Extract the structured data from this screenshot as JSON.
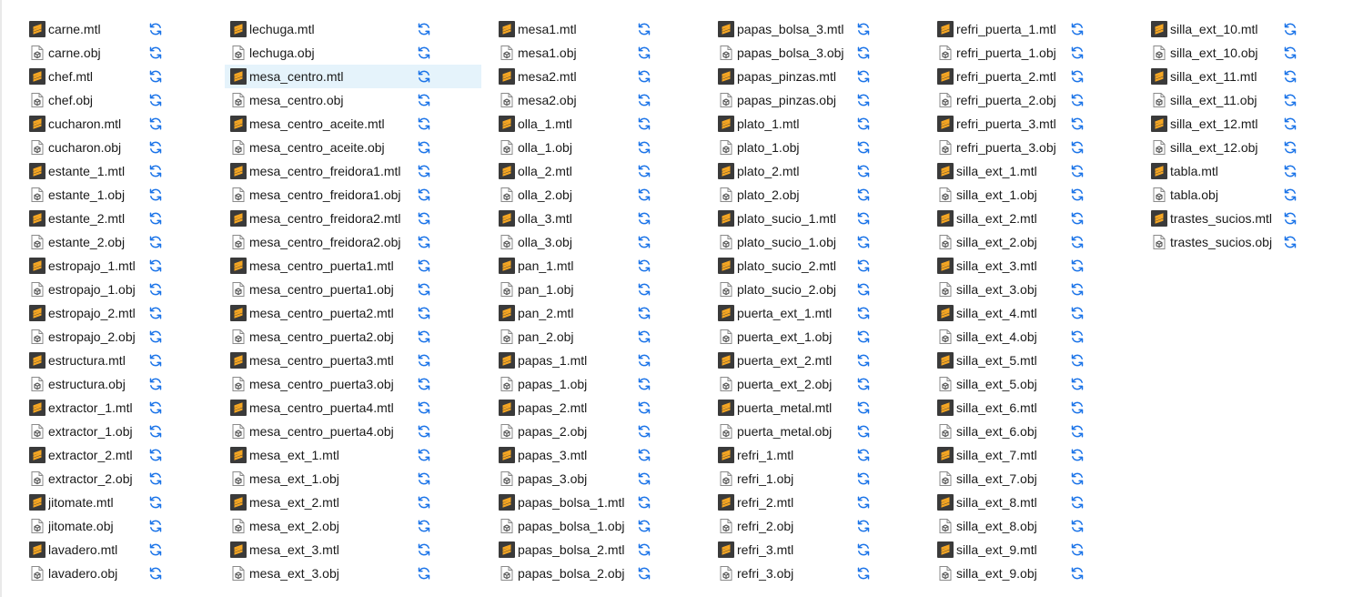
{
  "status_icon": "sync-pending-icon",
  "colors": {
    "accent": "#1a73e8",
    "selection": "#e5f3fb",
    "mtl_icon": "#f5a623",
    "obj_icon": "#555555"
  },
  "columns": [
    {
      "files": [
        {
          "name": "carne.mtl",
          "type": "mtl"
        },
        {
          "name": "carne.obj",
          "type": "obj"
        },
        {
          "name": "chef.mtl",
          "type": "mtl"
        },
        {
          "name": "chef.obj",
          "type": "obj"
        },
        {
          "name": "cucharon.mtl",
          "type": "mtl"
        },
        {
          "name": "cucharon.obj",
          "type": "obj"
        },
        {
          "name": "estante_1.mtl",
          "type": "mtl"
        },
        {
          "name": "estante_1.obj",
          "type": "obj"
        },
        {
          "name": "estante_2.mtl",
          "type": "mtl"
        },
        {
          "name": "estante_2.obj",
          "type": "obj"
        },
        {
          "name": "estropajo_1.mtl",
          "type": "mtl"
        },
        {
          "name": "estropajo_1.obj",
          "type": "obj"
        },
        {
          "name": "estropajo_2.mtl",
          "type": "mtl"
        },
        {
          "name": "estropajo_2.obj",
          "type": "obj"
        },
        {
          "name": "estructura.mtl",
          "type": "mtl"
        },
        {
          "name": "estructura.obj",
          "type": "obj"
        },
        {
          "name": "extractor_1.mtl",
          "type": "mtl"
        },
        {
          "name": "extractor_1.obj",
          "type": "obj"
        },
        {
          "name": "extractor_2.mtl",
          "type": "mtl"
        },
        {
          "name": "extractor_2.obj",
          "type": "obj"
        },
        {
          "name": "jitomate.mtl",
          "type": "mtl"
        },
        {
          "name": "jitomate.obj",
          "type": "obj"
        },
        {
          "name": "lavadero.mtl",
          "type": "mtl"
        },
        {
          "name": "lavadero.obj",
          "type": "obj"
        }
      ]
    },
    {
      "files": [
        {
          "name": "lechuga.mtl",
          "type": "mtl"
        },
        {
          "name": "lechuga.obj",
          "type": "obj"
        },
        {
          "name": "mesa_centro.mtl",
          "type": "mtl",
          "selected": true
        },
        {
          "name": "mesa_centro.obj",
          "type": "obj"
        },
        {
          "name": "mesa_centro_aceite.mtl",
          "type": "mtl"
        },
        {
          "name": "mesa_centro_aceite.obj",
          "type": "obj"
        },
        {
          "name": "mesa_centro_freidora1.mtl",
          "type": "mtl"
        },
        {
          "name": "mesa_centro_freidora1.obj",
          "type": "obj"
        },
        {
          "name": "mesa_centro_freidora2.mtl",
          "type": "mtl"
        },
        {
          "name": "mesa_centro_freidora2.obj",
          "type": "obj"
        },
        {
          "name": "mesa_centro_puerta1.mtl",
          "type": "mtl"
        },
        {
          "name": "mesa_centro_puerta1.obj",
          "type": "obj"
        },
        {
          "name": "mesa_centro_puerta2.mtl",
          "type": "mtl"
        },
        {
          "name": "mesa_centro_puerta2.obj",
          "type": "obj"
        },
        {
          "name": "mesa_centro_puerta3.mtl",
          "type": "mtl"
        },
        {
          "name": "mesa_centro_puerta3.obj",
          "type": "obj"
        },
        {
          "name": "mesa_centro_puerta4.mtl",
          "type": "mtl"
        },
        {
          "name": "mesa_centro_puerta4.obj",
          "type": "obj"
        },
        {
          "name": "mesa_ext_1.mtl",
          "type": "mtl"
        },
        {
          "name": "mesa_ext_1.obj",
          "type": "obj"
        },
        {
          "name": "mesa_ext_2.mtl",
          "type": "mtl"
        },
        {
          "name": "mesa_ext_2.obj",
          "type": "obj"
        },
        {
          "name": "mesa_ext_3.mtl",
          "type": "mtl"
        },
        {
          "name": "mesa_ext_3.obj",
          "type": "obj"
        }
      ]
    },
    {
      "files": [
        {
          "name": "mesa1.mtl",
          "type": "mtl"
        },
        {
          "name": "mesa1.obj",
          "type": "obj"
        },
        {
          "name": "mesa2.mtl",
          "type": "mtl"
        },
        {
          "name": "mesa2.obj",
          "type": "obj"
        },
        {
          "name": "olla_1.mtl",
          "type": "mtl"
        },
        {
          "name": "olla_1.obj",
          "type": "obj"
        },
        {
          "name": "olla_2.mtl",
          "type": "mtl"
        },
        {
          "name": "olla_2.obj",
          "type": "obj"
        },
        {
          "name": "olla_3.mtl",
          "type": "mtl"
        },
        {
          "name": "olla_3.obj",
          "type": "obj"
        },
        {
          "name": "pan_1.mtl",
          "type": "mtl"
        },
        {
          "name": "pan_1.obj",
          "type": "obj"
        },
        {
          "name": "pan_2.mtl",
          "type": "mtl"
        },
        {
          "name": "pan_2.obj",
          "type": "obj"
        },
        {
          "name": "papas_1.mtl",
          "type": "mtl"
        },
        {
          "name": "papas_1.obj",
          "type": "obj"
        },
        {
          "name": "papas_2.mtl",
          "type": "mtl"
        },
        {
          "name": "papas_2.obj",
          "type": "obj"
        },
        {
          "name": "papas_3.mtl",
          "type": "mtl"
        },
        {
          "name": "papas_3.obj",
          "type": "obj"
        },
        {
          "name": "papas_bolsa_1.mtl",
          "type": "mtl"
        },
        {
          "name": "papas_bolsa_1.obj",
          "type": "obj"
        },
        {
          "name": "papas_bolsa_2.mtl",
          "type": "mtl"
        },
        {
          "name": "papas_bolsa_2.obj",
          "type": "obj"
        }
      ]
    },
    {
      "files": [
        {
          "name": "papas_bolsa_3.mtl",
          "type": "mtl"
        },
        {
          "name": "papas_bolsa_3.obj",
          "type": "obj"
        },
        {
          "name": "papas_pinzas.mtl",
          "type": "mtl"
        },
        {
          "name": "papas_pinzas.obj",
          "type": "obj"
        },
        {
          "name": "plato_1.mtl",
          "type": "mtl"
        },
        {
          "name": "plato_1.obj",
          "type": "obj"
        },
        {
          "name": "plato_2.mtl",
          "type": "mtl"
        },
        {
          "name": "plato_2.obj",
          "type": "obj"
        },
        {
          "name": "plato_sucio_1.mtl",
          "type": "mtl"
        },
        {
          "name": "plato_sucio_1.obj",
          "type": "obj"
        },
        {
          "name": "plato_sucio_2.mtl",
          "type": "mtl"
        },
        {
          "name": "plato_sucio_2.obj",
          "type": "obj"
        },
        {
          "name": "puerta_ext_1.mtl",
          "type": "mtl"
        },
        {
          "name": "puerta_ext_1.obj",
          "type": "obj"
        },
        {
          "name": "puerta_ext_2.mtl",
          "type": "mtl"
        },
        {
          "name": "puerta_ext_2.obj",
          "type": "obj"
        },
        {
          "name": "puerta_metal.mtl",
          "type": "mtl"
        },
        {
          "name": "puerta_metal.obj",
          "type": "obj"
        },
        {
          "name": "refri_1.mtl",
          "type": "mtl"
        },
        {
          "name": "refri_1.obj",
          "type": "obj"
        },
        {
          "name": "refri_2.mtl",
          "type": "mtl"
        },
        {
          "name": "refri_2.obj",
          "type": "obj"
        },
        {
          "name": "refri_3.mtl",
          "type": "mtl"
        },
        {
          "name": "refri_3.obj",
          "type": "obj"
        }
      ]
    },
    {
      "files": [
        {
          "name": "refri_puerta_1.mtl",
          "type": "mtl"
        },
        {
          "name": "refri_puerta_1.obj",
          "type": "obj"
        },
        {
          "name": "refri_puerta_2.mtl",
          "type": "mtl"
        },
        {
          "name": "refri_puerta_2.obj",
          "type": "obj"
        },
        {
          "name": "refri_puerta_3.mtl",
          "type": "mtl"
        },
        {
          "name": "refri_puerta_3.obj",
          "type": "obj"
        },
        {
          "name": "silla_ext_1.mtl",
          "type": "mtl"
        },
        {
          "name": "silla_ext_1.obj",
          "type": "obj"
        },
        {
          "name": "silla_ext_2.mtl",
          "type": "mtl"
        },
        {
          "name": "silla_ext_2.obj",
          "type": "obj"
        },
        {
          "name": "silla_ext_3.mtl",
          "type": "mtl"
        },
        {
          "name": "silla_ext_3.obj",
          "type": "obj"
        },
        {
          "name": "silla_ext_4.mtl",
          "type": "mtl"
        },
        {
          "name": "silla_ext_4.obj",
          "type": "obj"
        },
        {
          "name": "silla_ext_5.mtl",
          "type": "mtl"
        },
        {
          "name": "silla_ext_5.obj",
          "type": "obj"
        },
        {
          "name": "silla_ext_6.mtl",
          "type": "mtl"
        },
        {
          "name": "silla_ext_6.obj",
          "type": "obj"
        },
        {
          "name": "silla_ext_7.mtl",
          "type": "mtl"
        },
        {
          "name": "silla_ext_7.obj",
          "type": "obj"
        },
        {
          "name": "silla_ext_8.mtl",
          "type": "mtl"
        },
        {
          "name": "silla_ext_8.obj",
          "type": "obj"
        },
        {
          "name": "silla_ext_9.mtl",
          "type": "mtl"
        },
        {
          "name": "silla_ext_9.obj",
          "type": "obj"
        }
      ]
    },
    {
      "files": [
        {
          "name": "silla_ext_10.mtl",
          "type": "mtl"
        },
        {
          "name": "silla_ext_10.obj",
          "type": "obj"
        },
        {
          "name": "silla_ext_11.mtl",
          "type": "mtl"
        },
        {
          "name": "silla_ext_11.obj",
          "type": "obj"
        },
        {
          "name": "silla_ext_12.mtl",
          "type": "mtl"
        },
        {
          "name": "silla_ext_12.obj",
          "type": "obj"
        },
        {
          "name": "tabla.mtl",
          "type": "mtl"
        },
        {
          "name": "tabla.obj",
          "type": "obj"
        },
        {
          "name": "trastes_sucios.mtl",
          "type": "mtl"
        },
        {
          "name": "trastes_sucios.obj",
          "type": "obj"
        }
      ]
    }
  ]
}
